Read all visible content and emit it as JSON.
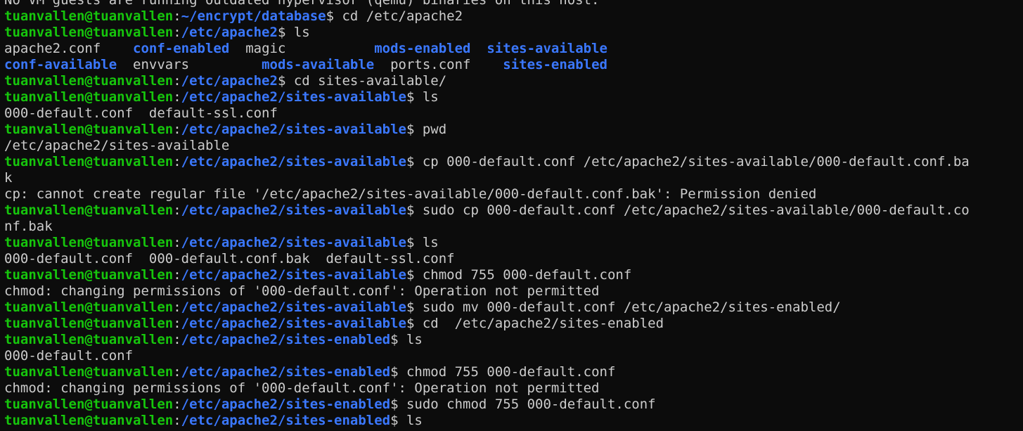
{
  "terminal": {
    "lines": [
      {
        "kind": "output",
        "text": "No VM guests are running outdated hypervisor (qemu) binaries on this host."
      },
      {
        "kind": "prompt",
        "user": "tuanvallen@tuanvallen",
        "sep": ":",
        "path": "~/encrypt/database",
        "dollar": "$ ",
        "cmd": "cd /etc/apache2"
      },
      {
        "kind": "prompt",
        "user": "tuanvallen@tuanvallen",
        "sep": ":",
        "path": "/etc/apache2",
        "dollar": "$ ",
        "cmd": "ls"
      },
      {
        "kind": "listing",
        "items": [
          {
            "text": "apache2.conf    ",
            "dir": false
          },
          {
            "text": "conf-enabled",
            "dir": true
          },
          {
            "text": "  magic           ",
            "dir": false
          },
          {
            "text": "mods-enabled",
            "dir": true
          },
          {
            "text": "  ",
            "dir": false
          },
          {
            "text": "sites-available",
            "dir": true
          }
        ]
      },
      {
        "kind": "listing",
        "items": [
          {
            "text": "conf-available",
            "dir": true
          },
          {
            "text": "  envvars         ",
            "dir": false
          },
          {
            "text": "mods-available",
            "dir": true
          },
          {
            "text": "  ports.conf    ",
            "dir": false
          },
          {
            "text": "sites-enabled",
            "dir": true
          }
        ]
      },
      {
        "kind": "prompt",
        "user": "tuanvallen@tuanvallen",
        "sep": ":",
        "path": "/etc/apache2",
        "dollar": "$ ",
        "cmd": "cd sites-available/"
      },
      {
        "kind": "prompt",
        "user": "tuanvallen@tuanvallen",
        "sep": ":",
        "path": "/etc/apache2/sites-available",
        "dollar": "$ ",
        "cmd": "ls"
      },
      {
        "kind": "output",
        "text": "000-default.conf  default-ssl.conf"
      },
      {
        "kind": "prompt",
        "user": "tuanvallen@tuanvallen",
        "sep": ":",
        "path": "/etc/apache2/sites-available",
        "dollar": "$ ",
        "cmd": "pwd"
      },
      {
        "kind": "output",
        "text": "/etc/apache2/sites-available"
      },
      {
        "kind": "prompt",
        "user": "tuanvallen@tuanvallen",
        "sep": ":",
        "path": "/etc/apache2/sites-available",
        "dollar": "$ ",
        "cmd": "cp 000-default.conf /etc/apache2/sites-available/000-default.conf.ba"
      },
      {
        "kind": "output",
        "text": "k"
      },
      {
        "kind": "output",
        "text": "cp: cannot create regular file '/etc/apache2/sites-available/000-default.conf.bak': Permission denied"
      },
      {
        "kind": "prompt",
        "user": "tuanvallen@tuanvallen",
        "sep": ":",
        "path": "/etc/apache2/sites-available",
        "dollar": "$ ",
        "cmd": "sudo cp 000-default.conf /etc/apache2/sites-available/000-default.co"
      },
      {
        "kind": "output",
        "text": "nf.bak"
      },
      {
        "kind": "prompt",
        "user": "tuanvallen@tuanvallen",
        "sep": ":",
        "path": "/etc/apache2/sites-available",
        "dollar": "$ ",
        "cmd": "ls"
      },
      {
        "kind": "output",
        "text": "000-default.conf  000-default.conf.bak  default-ssl.conf"
      },
      {
        "kind": "prompt",
        "user": "tuanvallen@tuanvallen",
        "sep": ":",
        "path": "/etc/apache2/sites-available",
        "dollar": "$ ",
        "cmd": "chmod 755 000-default.conf"
      },
      {
        "kind": "output",
        "text": "chmod: changing permissions of '000-default.conf': Operation not permitted"
      },
      {
        "kind": "prompt",
        "user": "tuanvallen@tuanvallen",
        "sep": ":",
        "path": "/etc/apache2/sites-available",
        "dollar": "$ ",
        "cmd": "sudo mv 000-default.conf /etc/apache2/sites-enabled/"
      },
      {
        "kind": "prompt",
        "user": "tuanvallen@tuanvallen",
        "sep": ":",
        "path": "/etc/apache2/sites-available",
        "dollar": "$ ",
        "cmd": "cd  /etc/apache2/sites-enabled"
      },
      {
        "kind": "prompt",
        "user": "tuanvallen@tuanvallen",
        "sep": ":",
        "path": "/etc/apache2/sites-enabled",
        "dollar": "$ ",
        "cmd": "ls"
      },
      {
        "kind": "output",
        "text": "000-default.conf"
      },
      {
        "kind": "prompt",
        "user": "tuanvallen@tuanvallen",
        "sep": ":",
        "path": "/etc/apache2/sites-enabled",
        "dollar": "$ ",
        "cmd": "chmod 755 000-default.conf"
      },
      {
        "kind": "output",
        "text": "chmod: changing permissions of '000-default.conf': Operation not permitted"
      },
      {
        "kind": "prompt",
        "user": "tuanvallen@tuanvallen",
        "sep": ":",
        "path": "/etc/apache2/sites-enabled",
        "dollar": "$ ",
        "cmd": "sudo chmod 755 000-default.conf"
      },
      {
        "kind": "prompt",
        "user": "tuanvallen@tuanvallen",
        "sep": ":",
        "path": "/etc/apache2/sites-enabled",
        "dollar": "$ ",
        "cmd": "ls"
      }
    ]
  },
  "colors": {
    "background": "#0c0c0c",
    "text": "#cccccc",
    "prompt_user": "#16c60c",
    "prompt_path": "#3b78ff",
    "directory": "#3b78ff"
  }
}
